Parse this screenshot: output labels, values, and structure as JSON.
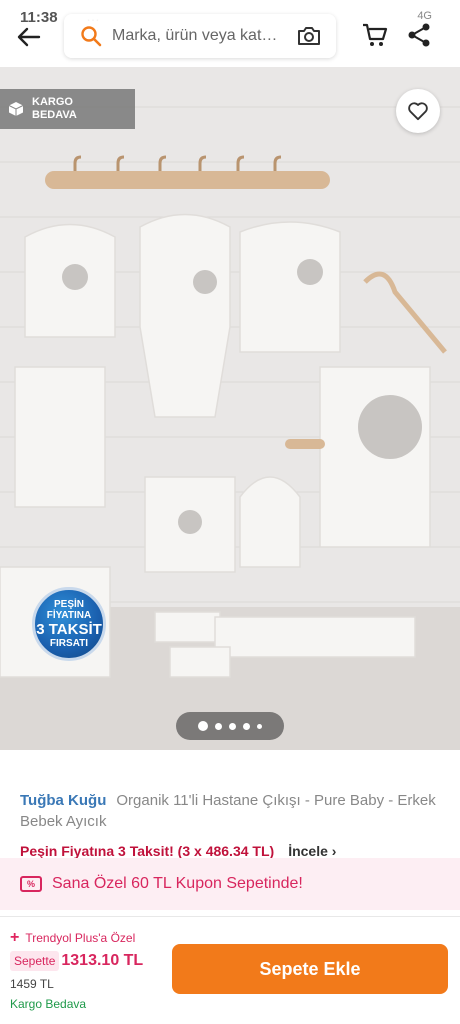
{
  "status_bar": {
    "time": "11:38",
    "indicators": "…",
    "right": "4G"
  },
  "header": {
    "search_placeholder": "Marka, ürün veya kat…"
  },
  "image": {
    "badge": {
      "line1": "KARGO",
      "line2": "BEDAVA"
    },
    "promo_seal": {
      "line1": "PEŞİN",
      "line2": "FİYATINA",
      "line3": "3 TAKSİT",
      "line4": "FIRSATI"
    },
    "carousel_count": 5,
    "carousel_active": 1
  },
  "product": {
    "brand": "Tuğba Kuğu",
    "name": "Organik 11'li Hastane Çıkışı - Pure Baby - Erkek Bebek Ayıcık",
    "installment": "Peşin Fiyatına 3 Taksit! (3 x 486.34 TL)",
    "installment_link": "İncele"
  },
  "coupon": {
    "icon_text": "%",
    "text": "Sana Özel 60 TL Kupon Sepetinde!"
  },
  "bottom": {
    "plus_label": "Trendyol Plus'a Özel",
    "sepette_label": "Sepette",
    "price": "1313.10 TL",
    "old_price": "1459 TL",
    "shipping": "Kargo Bedava",
    "add_button": "Sepete Ekle"
  },
  "colors": {
    "accent": "#f27a1a",
    "brand": "#3a78b6",
    "pink": "#d8265e",
    "green": "#1f9a4a"
  }
}
